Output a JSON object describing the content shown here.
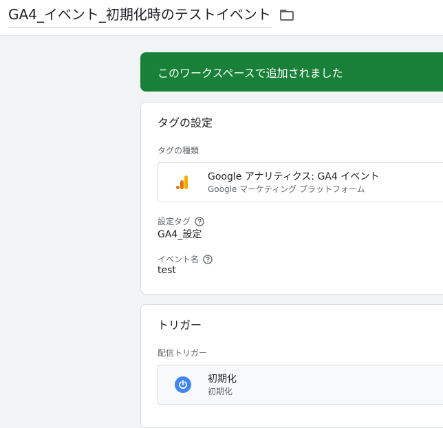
{
  "header": {
    "tag_name": "GA4_イベント_初期化時のテストイベント",
    "folder_icon": "folder-icon"
  },
  "banner": {
    "message": "このワークスペースで追加されました",
    "color": "#188038"
  },
  "tag_config": {
    "title": "タグの設定",
    "type_label": "タグの種類",
    "type": {
      "name": "Google アナリティクス: GA4 イベント",
      "vendor": "Google マーケティング プラットフォーム",
      "icon": "google-analytics-icon"
    },
    "config_tag_label": "設定タグ",
    "config_tag_value": "GA4_設定",
    "event_name_label": "イベント名",
    "event_name_value": "test",
    "help_icon": "help-circle-icon"
  },
  "trigger": {
    "title": "トリガー",
    "firing_label": "配信トリガー",
    "item": {
      "name": "初期化",
      "type": "初期化",
      "icon": "power-icon",
      "icon_color": "#4285f4"
    }
  }
}
